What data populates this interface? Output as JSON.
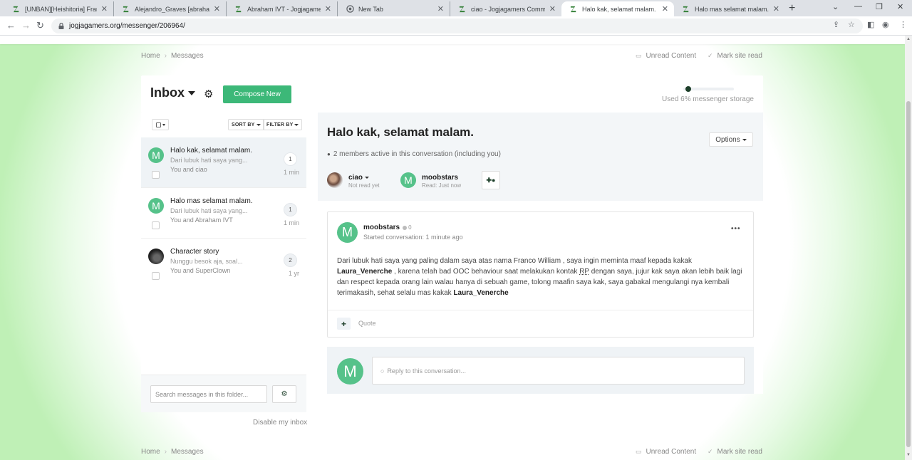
{
  "browser": {
    "tabs": [
      {
        "title": "[UNBAN][Heishitoria] Franco W",
        "favicon": "jogjagamers-icon"
      },
      {
        "title": "Alejandro_Graves [abrahamivt]",
        "favicon": "jogjagamers-icon"
      },
      {
        "title": "Abraham IVT - Jogjagamers Co",
        "favicon": "jogjagamers-icon"
      },
      {
        "title": "New Tab",
        "favicon": "chrome-icon"
      },
      {
        "title": "ciao - Jogjagamers Community",
        "favicon": "jogjagamers-icon"
      },
      {
        "title": "Halo kak, selamat malam.",
        "favicon": "jogjagamers-icon"
      },
      {
        "title": "Halo mas selamat malam. - Jog",
        "favicon": "jogjagamers-icon"
      }
    ],
    "url": "jogjagamers.org/messenger/206964/"
  },
  "breadcrumb": {
    "home": "Home",
    "messages": "Messages",
    "separator": "›"
  },
  "site_actions": {
    "unread": "Unread Content",
    "mark_read": "Mark site read"
  },
  "inbox": {
    "title": "Inbox",
    "compose_label": "Compose New",
    "storage_text": "Used 6% messenger storage",
    "storage_used_fraction": 0.06
  },
  "list_toolbar": {
    "sort_label": "SORT BY",
    "filter_label": "FILTER BY"
  },
  "conversations": [
    {
      "title": "Halo kak, selamat malam.",
      "snippet": "Dari lubuk hati saya yang...",
      "participants": "You and ciao",
      "count": "1",
      "time": "1 min",
      "avatar": "M"
    },
    {
      "title": "Halo mas selamat malam.",
      "snippet": "Dari lubuk hati saya yang...",
      "participants": "You and Abraham IVT",
      "count": "1",
      "time": "1 min",
      "avatar": "M"
    },
    {
      "title": "Character story",
      "snippet": "Nunggu besok aja, soal...",
      "participants": "You and SuperClown",
      "count": "2",
      "time": "1 yr",
      "avatar": ""
    }
  ],
  "folder_search": {
    "placeholder": "Search messages in this folder..."
  },
  "disable_inbox": "Disable my inbox",
  "conversation": {
    "title": "Halo kak, selamat malam.",
    "options_label": "Options",
    "members_text": "2 members active in this conversation (including you)",
    "participants": [
      {
        "name": "ciao",
        "status": "Not read yet",
        "avatar": ""
      },
      {
        "name": "moobstars",
        "status": "Read: Just now",
        "avatar": "M"
      }
    ],
    "message": {
      "author": "moobstars",
      "avatar": "M",
      "reputation": "0",
      "started": "Started conversation: 1 minute ago",
      "body": {
        "p1": "Dari lubuk hati saya yang paling dalam saya atas nama Franco William , saya ingin meminta maaf kepada kakak ",
        "mention1": "Laura_Venerche",
        "p2": "  , karena telah bad OOC behaviour saat melakukan kontak ",
        "abbr": "RP",
        "p3": " dengan saya, jujur kak saya akan lebih baik lagi dan respect kepada orang lain walau hanya di sebuah game, tolong maafin saya kak, saya gabakal mengulangi nya kembali terimakasih, sehat selalu mas kakak ",
        "mention2": "Laura_Venerche"
      },
      "quote_label": "Quote"
    },
    "reply_placeholder": "Reply to this conversation...",
    "reply_avatar": "M"
  },
  "colors": {
    "accent": "#3cb878",
    "avatar": "#56c28a",
    "dark": "#1d3f2a"
  }
}
